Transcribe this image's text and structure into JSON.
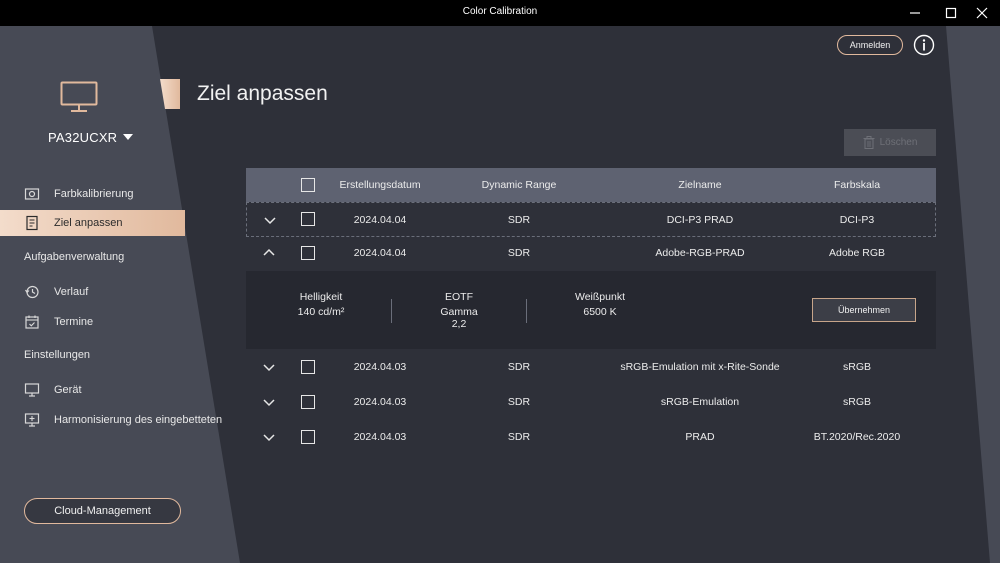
{
  "window": {
    "title": "Color Calibration"
  },
  "device": {
    "name": "PA32UCXR"
  },
  "nav": {
    "calibration": "Farbkalibrierung",
    "target": "Ziel anpassen",
    "task_section": "Aufgabenverwaltung",
    "history": "Verlauf",
    "schedule": "Termine",
    "settings_section": "Einstellungen",
    "device": "Gerät",
    "harmonize": "Harmonisierung des eingebetteten"
  },
  "cloud_button": "Cloud-Management",
  "header": {
    "title": "Ziel anpassen",
    "login": "Anmelden"
  },
  "toolbar": {
    "delete": "Löschen"
  },
  "table": {
    "columns": [
      "Erstellungsdatum",
      "Dynamic Range",
      "Zielname",
      "Farbskala"
    ],
    "rows": [
      {
        "date": "2024.04.04",
        "range": "SDR",
        "name": "DCI-P3 PRAD",
        "gamut": "DCI-P3"
      },
      {
        "date": "2024.04.04",
        "range": "SDR",
        "name": "Adobe-RGB-PRAD",
        "gamut": "Adobe RGB"
      },
      {
        "date": "2024.04.03",
        "range": "SDR",
        "name": "sRGB-Emulation mit x-Rite-Sonde",
        "gamut": "sRGB"
      },
      {
        "date": "2024.04.03",
        "range": "SDR",
        "name": "sRGB-Emulation",
        "gamut": "sRGB"
      },
      {
        "date": "2024.04.03",
        "range": "SDR",
        "name": "PRAD",
        "gamut": "BT.2020/Rec.2020"
      }
    ]
  },
  "detail": {
    "brightness_label": "Helligkeit",
    "brightness_value": "140 cd/m²",
    "eotf_label": "EOTF",
    "eotf_value1": "Gamma",
    "eotf_value2": "2,2",
    "whitepoint_label": "Weißpunkt",
    "whitepoint_value": "6500 K",
    "apply": "Übernehmen"
  },
  "colors": {
    "accent": "#e1b99d",
    "background": "#2e3039",
    "sidebar": "#474a55",
    "table_header": "#5e6271"
  }
}
